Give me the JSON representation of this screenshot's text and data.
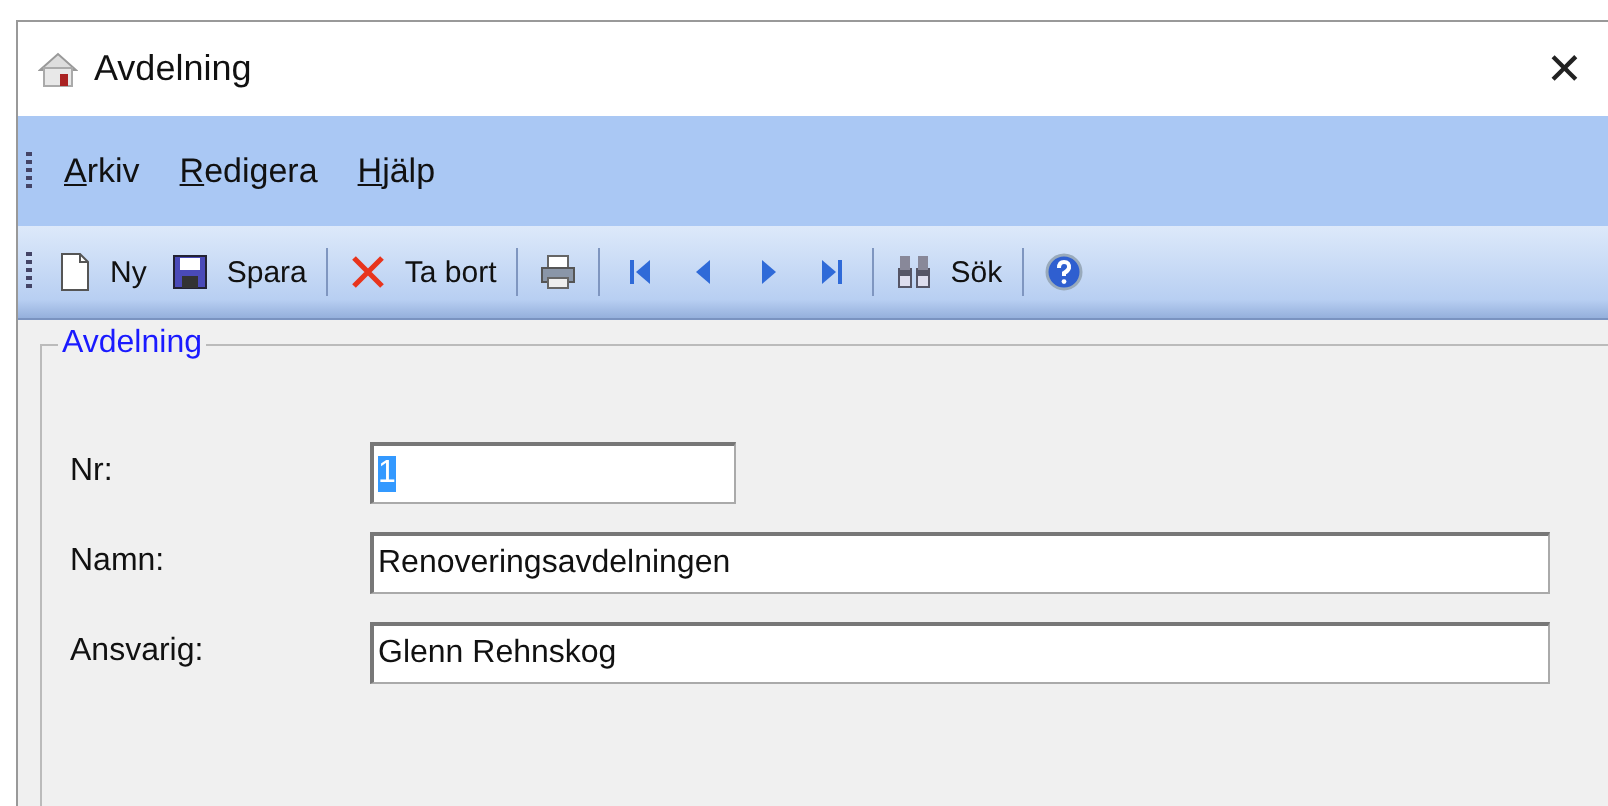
{
  "window": {
    "title": "Avdelning",
    "close": "✕"
  },
  "menu": [
    {
      "label": "Arkiv"
    },
    {
      "label": "Redigera"
    },
    {
      "label": "Hjälp"
    }
  ],
  "toolbar": [
    {
      "kind": "new",
      "label": "Ny"
    },
    {
      "kind": "save",
      "label": "Spara"
    },
    {
      "kind": "separator"
    },
    {
      "kind": "delete",
      "label": "Ta bort"
    },
    {
      "kind": "separator"
    },
    {
      "kind": "print"
    },
    {
      "kind": "separator"
    },
    {
      "kind": "first"
    },
    {
      "kind": "prev"
    },
    {
      "kind": "next"
    },
    {
      "kind": "last"
    },
    {
      "kind": "separator"
    },
    {
      "kind": "find",
      "label": "Sök"
    },
    {
      "kind": "separator"
    },
    {
      "kind": "help"
    }
  ],
  "group": {
    "title": "Avdelning",
    "fields": [
      {
        "label": "Nr:",
        "value": "1",
        "short": true,
        "text_selected": true
      },
      {
        "label": "Namn:",
        "value": "Renoveringsavdelningen",
        "short": false,
        "text_selected": false
      },
      {
        "label": "Ansvarig:",
        "value": "Glenn Rehnskog",
        "short": false,
        "text_selected": false
      }
    ]
  }
}
